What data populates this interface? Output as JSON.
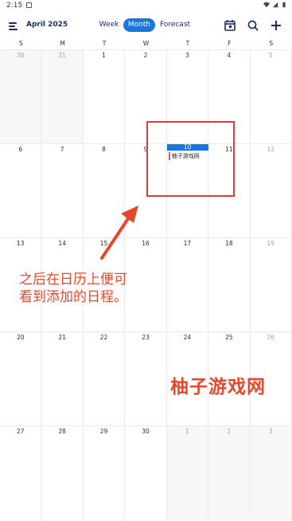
{
  "status": {
    "time": "2:15"
  },
  "header": {
    "title": "April 2025",
    "tabs": [
      "Week",
      "Month",
      "Forecast"
    ],
    "active_tab": "Month",
    "icons": [
      "menu-icon",
      "calendar-today-icon",
      "search-icon",
      "add-icon"
    ]
  },
  "weekdays": [
    "S",
    "M",
    "T",
    "W",
    "T",
    "F",
    "S"
  ],
  "weeks": [
    [
      "30",
      "31",
      "1",
      "2",
      "3",
      "4",
      "5"
    ],
    [
      "6",
      "7",
      "8",
      "9",
      "10",
      "11",
      "12"
    ],
    [
      "13",
      "14",
      "15",
      "16",
      "17",
      "18",
      "19"
    ],
    [
      "20",
      "21",
      "22",
      "23",
      "24",
      "25",
      "26"
    ],
    [
      "27",
      "28",
      "29",
      "30",
      "1",
      "2",
      "3"
    ]
  ],
  "today": "10",
  "event": {
    "title": "柚子游戏网"
  },
  "annotation": {
    "line1": "之后在日历上便可",
    "line2": "看到添加的日程。"
  },
  "watermark": "柚子游戏网",
  "colors": {
    "accent": "#1677e0",
    "annotation": "#e8472c"
  }
}
